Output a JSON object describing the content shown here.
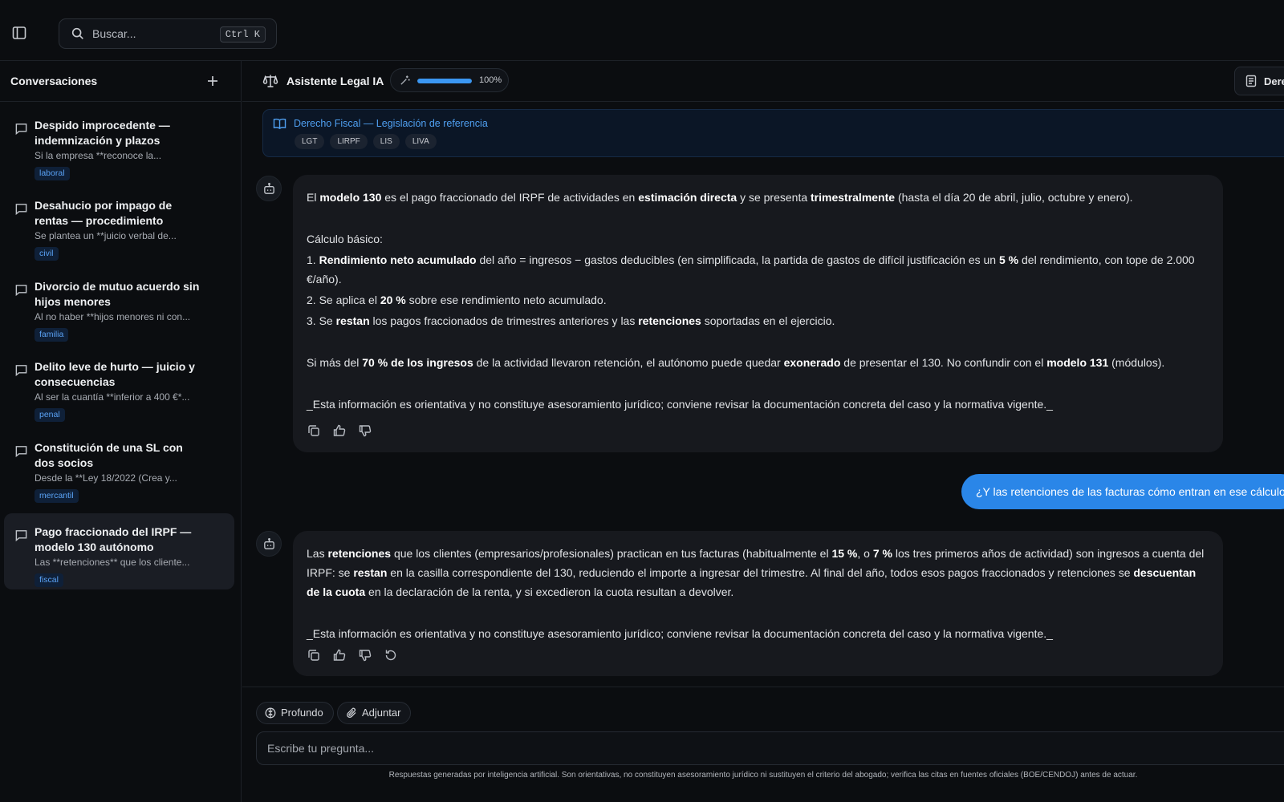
{
  "search": {
    "placeholder": "Buscar...",
    "shortcut": "Ctrl K"
  },
  "sidebar": {
    "title": "Conversaciones",
    "conversations": [
      {
        "title": "Despido improcedente — indemnización y plazos",
        "preview": "Si la empresa **reconoce la...",
        "tag": "laboral"
      },
      {
        "title": "Desahucio por impago de rentas — procedimiento",
        "preview": "Se plantea un **juicio verbal de...",
        "tag": "civil"
      },
      {
        "title": "Divorcio de mutuo acuerdo sin hijos menores",
        "preview": "Al no haber **hijos menores ni con...",
        "tag": "familia"
      },
      {
        "title": "Delito leve de hurto — juicio y consecuencias",
        "preview": "Al ser la cuantía **inferior a 400 €*...",
        "tag": "penal"
      },
      {
        "title": "Constitución de una SL con dos socios",
        "preview": "Desde la **Ley 18/2022 (Crea y...",
        "tag": "mercantil"
      },
      {
        "title": "Pago fraccionado del IRPF — modelo 130 autónomo",
        "preview": "Las **retenciones** que los cliente...",
        "tag": "fiscal"
      }
    ]
  },
  "header": {
    "title": "Asistente Legal IA",
    "progress_percent": 100,
    "progress_label": "100%",
    "area_label": "Derecho Fiscal"
  },
  "reference": {
    "title": "Derecho Fiscal — Legislación de referencia",
    "chips": [
      "LGT",
      "LIRPF",
      "LIS",
      "LIVA"
    ]
  },
  "messages": {
    "assistant1": {
      "p1": [
        "El ",
        "modelo 130",
        " es el pago fraccionado del IRPF de actividades en ",
        "estimación directa",
        " y se presenta ",
        "trimestralmente",
        " (hasta el día 20 de abril, julio, octubre y enero)."
      ],
      "calc_heading": "Cálculo básico:",
      "step1": [
        "1. ",
        "Rendimiento neto acumulado",
        " del año = ingresos − gastos deducibles (en simplificada, la partida de gastos de difícil justificación es un ",
        "5 %",
        " del rendimiento, con tope de 2.000 €/año)."
      ],
      "step2": [
        "2. Se aplica el ",
        "20 %",
        " sobre ese rendimiento neto acumulado."
      ],
      "step3": [
        "3. Se ",
        "restan",
        " los pagos fraccionados de trimestres anteriores y las ",
        "retenciones",
        " soportadas en el ejercicio."
      ],
      "p3": [
        "Si más del ",
        "70 % de los ingresos",
        " de la actividad llevaron retención, el autónomo puede quedar ",
        "exonerado",
        " de presentar el 130. No confundir con el ",
        "modelo 131",
        " (módulos)."
      ],
      "disclaimer": "_Esta información es orientativa y no constituye asesoramiento jurídico; conviene revisar la documentación concreta del caso y la normativa vigente._"
    },
    "user1": "¿Y las retenciones de las facturas cómo entran en ese cálculo?",
    "assistant2": {
      "p1": [
        "Las ",
        "retenciones",
        " que los clientes (empresarios/profesionales) practican en tus facturas (habitualmente el ",
        "15 %",
        ", o ",
        "7 %",
        " los tres primeros años de actividad) son ingresos a cuenta del IRPF: se ",
        "restan",
        " en la casilla correspondiente del 130, reduciendo el importe a ingresar del trimestre. Al final del año, todos esos pagos fraccionados y retenciones se ",
        "descuentan de la cuota",
        " en la declaración de la renta, y si excedieron la cuota resultan a devolver."
      ],
      "disclaimer": "_Esta información es orientativa y no constituye asesoramiento jurídico; conviene revisar la documentación concreta del caso y la normativa vigente._"
    }
  },
  "composer": {
    "deep_label": "Profundo",
    "attach_label": "Adjuntar",
    "placeholder": "Escribe tu pregunta...",
    "disclaimer": "Respuestas generadas por inteligencia artificial. Son orientativas, no constituyen asesoramiento jurídico ni sustituyen el criterio del abogado; verifica las citas en fuentes oficiales (BOE/CENDOJ) antes de actuar."
  },
  "colors": {
    "accent": "#2a86e8",
    "tag_text": "#5aa2f5",
    "background": "#0b0d10",
    "bubble": "#17191e"
  }
}
